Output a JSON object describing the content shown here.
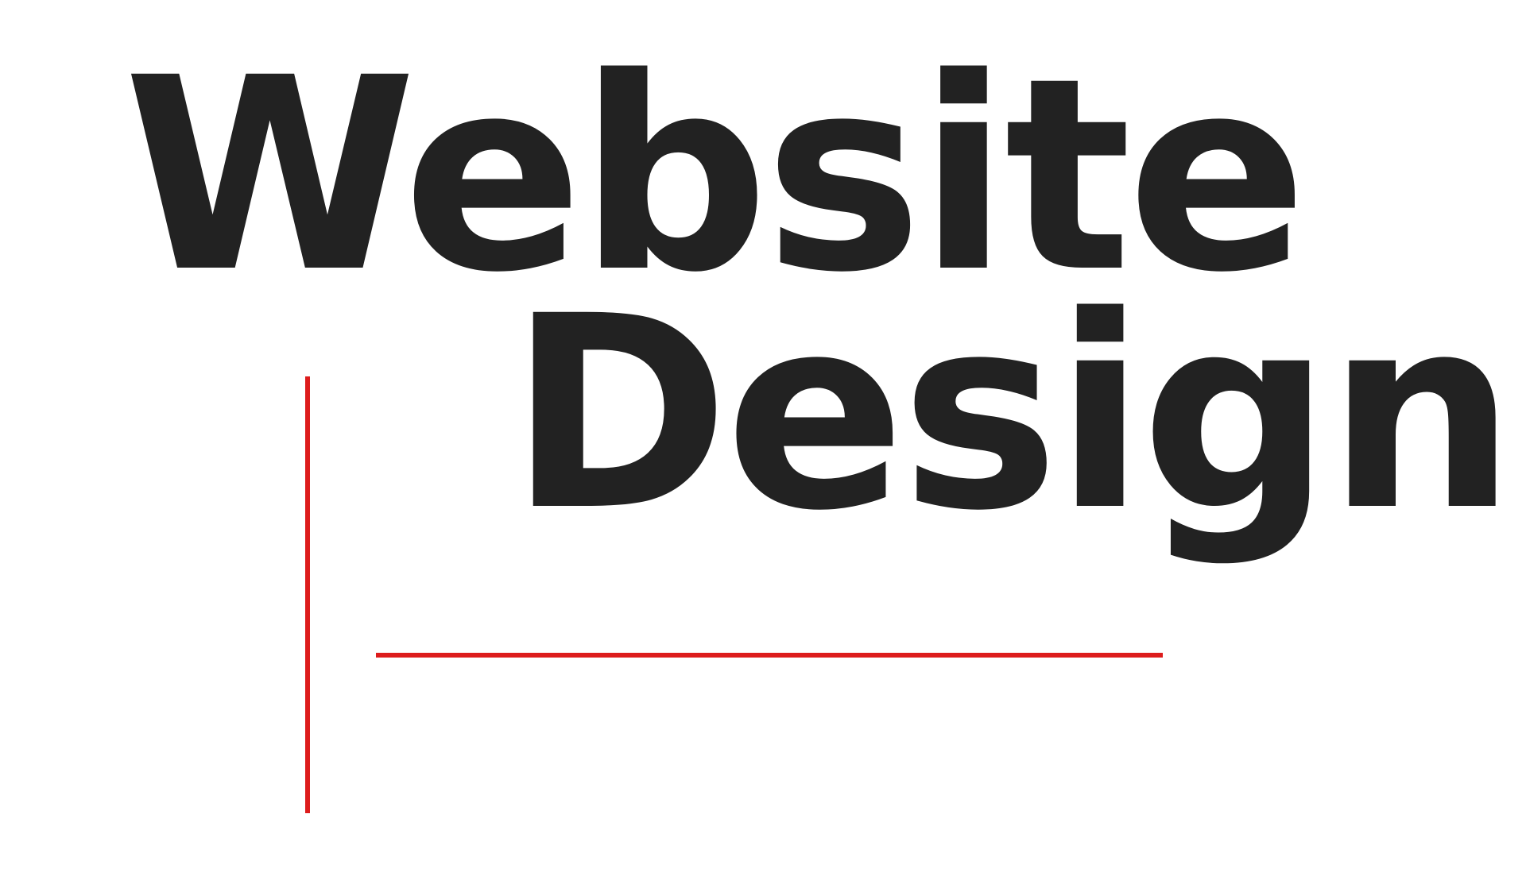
{
  "headline": {
    "line1": "Website",
    "line2": "Design"
  },
  "colors": {
    "text": "#222222",
    "accent": "#dd1c1c",
    "background": "#ffffff"
  }
}
